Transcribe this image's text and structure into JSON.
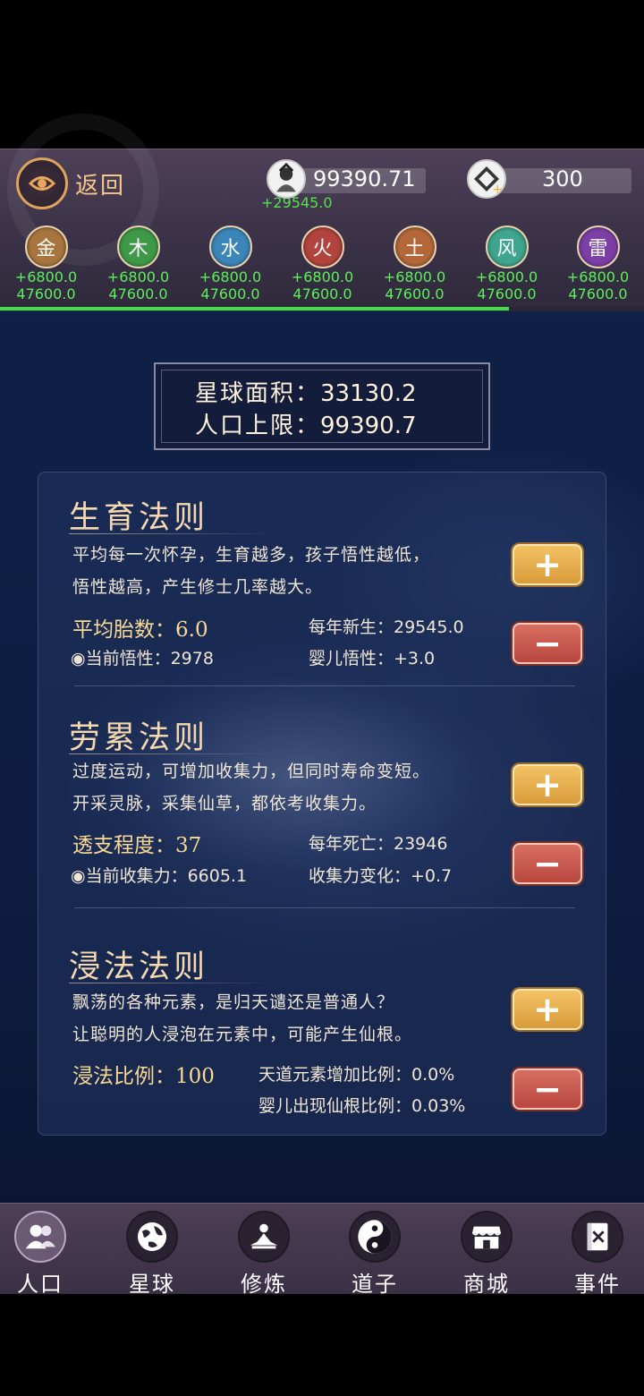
{
  "header": {
    "back_label": "返回",
    "population_value": "99390.71",
    "population_gain": "+29545.0",
    "gem_value": "300"
  },
  "elements": [
    {
      "name": "金",
      "gain": "+6800.0",
      "total": "47600.0",
      "color": "#a9753e"
    },
    {
      "name": "木",
      "gain": "+6800.0",
      "total": "47600.0",
      "color": "#3f9a48"
    },
    {
      "name": "水",
      "gain": "+6800.0",
      "total": "47600.0",
      "color": "#3c85b8"
    },
    {
      "name": "火",
      "gain": "+6800.0",
      "total": "47600.0",
      "color": "#b2433e"
    },
    {
      "name": "土",
      "gain": "+6800.0",
      "total": "47600.0",
      "color": "#b4683a"
    },
    {
      "name": "风",
      "gain": "+6800.0",
      "total": "47600.0",
      "color": "#3ea58e"
    },
    {
      "name": "雷",
      "gain": "+6800.0",
      "total": "47600.0",
      "color": "#7c3fa6"
    }
  ],
  "progress_fraction": 0.79,
  "planet": {
    "area_label": "星球面积：",
    "area_value": "33130.2",
    "limit_label": "人口上限：",
    "limit_value": "99390.7"
  },
  "laws": [
    {
      "title": "生育法则",
      "desc1": "平均每一次怀孕，生育越多，孩子悟性越低，",
      "desc2": "悟性越高，产生修士几率越大。",
      "main_stat": "平均胎数：6.0",
      "sub_stat": "◉当前悟性：2978",
      "right_stat1": "每年新生：29545.0",
      "right_stat2": "婴儿悟性：+3.0"
    },
    {
      "title": "劳累法则",
      "desc1": "过度运动，可增加收集力，但同时寿命变短。",
      "desc2": "开采灵脉，采集仙草，都依考收集力。",
      "main_stat": "透支程度：37",
      "sub_stat": "◉当前收集力：6605.1",
      "right_stat1": "每年死亡：23946",
      "right_stat2": "收集力变化：+0.7"
    },
    {
      "title": "浸法法则",
      "desc1": "飘荡的各种元素，是归天谴还是普通人？",
      "desc2": "让聪明的人浸泡在元素中，可能产生仙根。",
      "main_stat": "浸法比例：100",
      "sub_stat": "",
      "right_stat1": "天道元素增加比例：0.0%",
      "right_stat2": "婴儿出现仙根比例：0.03%"
    }
  ],
  "buttons": {
    "plus": "+",
    "minus": "−"
  },
  "nav": [
    {
      "label": "人口",
      "icon": "people-icon"
    },
    {
      "label": "星球",
      "icon": "globe-icon"
    },
    {
      "label": "修炼",
      "icon": "meditation-icon"
    },
    {
      "label": "道子",
      "icon": "yin-yang-icon"
    },
    {
      "label": "商城",
      "icon": "shop-icon"
    },
    {
      "label": "事件",
      "icon": "event-book-icon"
    }
  ]
}
